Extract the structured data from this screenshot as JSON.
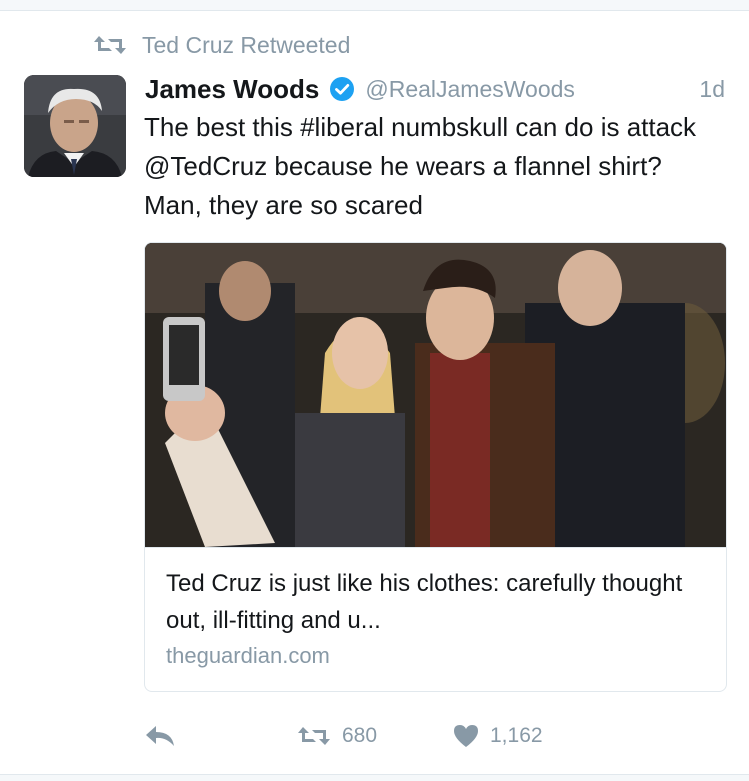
{
  "retweet_context": {
    "text": "Ted Cruz Retweeted",
    "icon": "retweet-icon"
  },
  "tweet": {
    "author": {
      "display_name": "James Woods",
      "handle": "@RealJamesWoods",
      "verified": true
    },
    "timestamp": "1d",
    "text": "The best this #liberal numbskull can do is attack @TedCruz because he wears a flannel shirt? Man, they are so scared",
    "card": {
      "title": "Ted Cruz is just like his clothes: carefully thought out, ill-fitting and u...",
      "domain": "theguardian.com"
    },
    "actions": {
      "retweet_count": "680",
      "like_count": "1,162"
    }
  },
  "colors": {
    "text_primary": "#14171a",
    "text_secondary": "#8899a6",
    "verified_blue": "#1da1f2",
    "border": "#e1e8ed"
  }
}
